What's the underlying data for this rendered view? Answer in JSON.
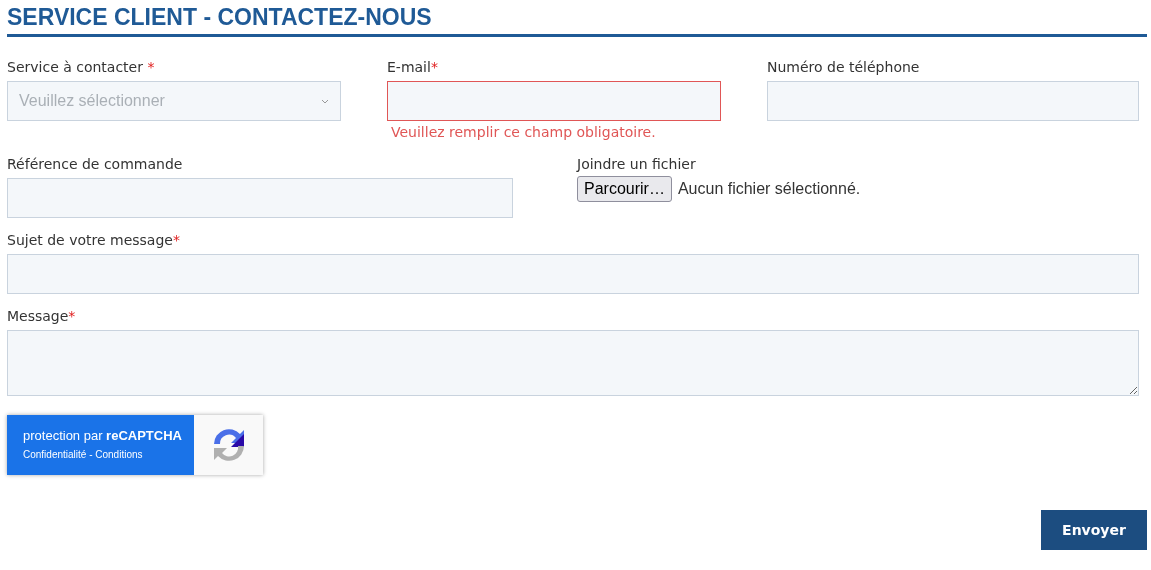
{
  "title": "SERVICE CLIENT - CONTACTEZ-NOUS",
  "rows": [
    {
      "fields": [
        {
          "kind": "select",
          "label": "Service à contacter",
          "required_mark": " *",
          "placeholder": "Veuillez sélectionner",
          "invalid": false
        },
        {
          "kind": "text",
          "label": "E-mail",
          "required_mark": "*",
          "invalid": true,
          "error": "Veuillez remplir ce champ obligatoire."
        },
        {
          "kind": "text",
          "label": "Numéro de téléphone",
          "invalid": false
        }
      ]
    },
    {
      "fields": [
        {
          "kind": "text",
          "label": "Référence de commande",
          "invalid": false
        },
        {
          "kind": "file",
          "label": "Joindre un fichier",
          "button": "Parcourir…",
          "status": "Aucun fichier sélectionné."
        }
      ]
    },
    {
      "fields": [
        {
          "kind": "text",
          "label": "Sujet de votre message",
          "required_mark": "*",
          "invalid": false
        }
      ]
    },
    {
      "fields": [
        {
          "kind": "textarea",
          "label": "Message",
          "required_mark": "*",
          "invalid": false
        }
      ]
    }
  ],
  "captcha": {
    "text": "protection par **reCAPTCHA**",
    "links": "Confidentialité - Conditions"
  },
  "submit": "Envoyer"
}
